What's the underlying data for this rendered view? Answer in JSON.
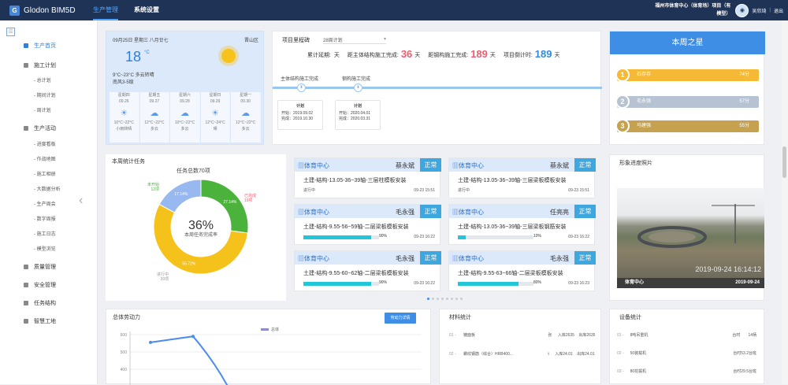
{
  "app": {
    "logo_text": "Glodon BIM5D",
    "logo_glyph": "G"
  },
  "nav": {
    "tabs": [
      "生产管理",
      "系统设置"
    ]
  },
  "header": {
    "project_line1": "福州市体育中心（体育场）项目（有",
    "project_line2": "模型）",
    "user": "吴欣琦",
    "logout": "退出"
  },
  "sidebar": {
    "sections": [
      {
        "label": "生产首页",
        "subs": []
      },
      {
        "label": "施工计划",
        "subs": [
          "总计划",
          "期间计划",
          "周计划"
        ]
      },
      {
        "label": "生产活动",
        "subs": [
          "进度看板",
          "作战地图",
          "施工相册",
          "大数据分析",
          "生产周会",
          "数字周报",
          "施工日志",
          "模型浏览"
        ]
      },
      {
        "label": "质量管理",
        "subs": []
      },
      {
        "label": "安全管理",
        "subs": []
      },
      {
        "label": "任务结构",
        "subs": []
      },
      {
        "label": "智慧工地",
        "subs": []
      }
    ]
  },
  "weather": {
    "date": "09月25日 星期三 八月廿七",
    "location": "晋山区",
    "temp": "18",
    "unit": "°C",
    "range": "9°C~23°C 多云转晴",
    "wind": "南风3-5级",
    "forecast": [
      {
        "day": "星期四",
        "date": "09.26",
        "icon": "sun-icon",
        "glyph": "☀",
        "temp": "10°C~22°C",
        "desc": "小雨转晴"
      },
      {
        "day": "星期五",
        "date": "09.27",
        "icon": "cloud-icon",
        "glyph": "☁",
        "temp": "12°C~22°C",
        "desc": "多云"
      },
      {
        "day": "星期六",
        "date": "09.28",
        "icon": "cloud-icon",
        "glyph": "☁",
        "temp": "10°C~22°C",
        "desc": "多云"
      },
      {
        "day": "星期日",
        "date": "09.29",
        "icon": "sun-icon",
        "glyph": "☀",
        "temp": "12°C~24°C",
        "desc": "晴"
      },
      {
        "day": "星期一",
        "date": "09.30",
        "icon": "cloud-icon",
        "glyph": "☁",
        "temp": "12°C~22°C",
        "desc": "多云"
      }
    ]
  },
  "milestone": {
    "title": "项目里程碑",
    "selected_plan": "28周计划",
    "stats": {
      "delay_label": "累计延期:",
      "delay_unit": "天",
      "main_label": "距主体结构施工完成:",
      "main_value": "36",
      "main_unit": "天",
      "steel_label": "距钢构施工完成:",
      "steel_value": "189",
      "steel_unit": "天",
      "countdown_label": "项目倒计时:",
      "countdown_value": "189",
      "countdown_unit": "天"
    },
    "nodes": [
      {
        "label": "主体结构施工完成",
        "title": "计划",
        "start": "开始：2019.09.02",
        "end": "完成：2019.10.30"
      },
      {
        "label": "钢构施工完成",
        "title": "计划",
        "start": "开始：2020.04.01",
        "end": "完成：2020.03.31"
      }
    ]
  },
  "stars": {
    "title": "本周之星",
    "items": [
      {
        "rank": "1",
        "name": "石存存",
        "score": "74分",
        "color": "#f5b935"
      },
      {
        "rank": "2",
        "name": "毛永强",
        "score": "57分",
        "color": "#b7c3d2"
      },
      {
        "rank": "3",
        "name": "马建强",
        "score": "55分",
        "color": "#c5a150"
      }
    ]
  },
  "tasks": {
    "title": "本周统计任务",
    "total": "任务总数70项",
    "center_pct": "36%",
    "center_label": "本周任务完成率",
    "segments": [
      {
        "name": "已完成",
        "pct": 27.14,
        "label": "27.14%",
        "color": "#4bb33b"
      },
      {
        "name": "进行中",
        "pct": 55.72,
        "label": "55.72%",
        "color": "#f5c21c"
      },
      {
        "name": "未开始",
        "pct": 17.14,
        "label": "17.14%",
        "color": "#98b9ef"
      }
    ],
    "outer_labels": {
      "done": "已完成\n19项",
      "doing": "进行中\n39项",
      "todo": "未开始\n12项"
    }
  },
  "task_cards": [
    {
      "org": "体育中心",
      "person": "蔡永斌",
      "status": "正常",
      "task": "土建-结构-13.05-36~39轴-三层柱模板安装",
      "progress_text": "进行中",
      "progress": null,
      "time": "09-23 15:51"
    },
    {
      "org": "体育中心",
      "person": "蔡永斌",
      "status": "正常",
      "task": "土建-结构-13.05-36~39轴-三层梁板模板安装",
      "progress_text": "进行中",
      "progress": null,
      "time": "09-23 15:51"
    },
    {
      "org": "体育中心",
      "person": "毛永强",
      "status": "正常",
      "task": "土建-结构-9.55-56~59轴-二层梁板模板安装",
      "progress_text": "",
      "progress": 90,
      "pct_label": "90%",
      "time": "09-23 16:22"
    },
    {
      "org": "体育中心",
      "person": "任亮亮",
      "status": "正常",
      "task": "土建-结构-13.05-36~39轴-三层梁板钢筋安装",
      "progress_text": "",
      "progress": 10,
      "pct_label": "10%",
      "time": "09-23 16:22"
    },
    {
      "org": "体育中心",
      "person": "毛永强",
      "status": "正常",
      "task": "土建-结构-9.55-60~62轴-二层梁板模板安装",
      "progress_text": "",
      "progress": 90,
      "pct_label": "90%",
      "time": "09-23 16:22"
    },
    {
      "org": "体育中心",
      "person": "毛永强",
      "status": "正常",
      "task": "土建-结构-9.55-63~66轴-二层梁板模板安装",
      "progress_text": "",
      "progress": 80,
      "pct_label": "80%",
      "time": "09-23 16:23"
    }
  ],
  "photo": {
    "title": "形象进度照片",
    "stamp": "2019-09-24 16:14:12",
    "caption_left": "体育中心",
    "caption_right": "2019-09-24"
  },
  "labor": {
    "title": "总体劳动力",
    "button": "劳动力详情",
    "legend": "总体",
    "chart_data": {
      "type": "line",
      "series": [
        {
          "name": "总体",
          "x": [
            1,
            2,
            3,
            4
          ],
          "values": [
            555,
            590,
            430,
            250
          ]
        }
      ],
      "yticks": [
        "600",
        "500",
        "400"
      ],
      "ylim": [
        400,
        600
      ]
    }
  },
  "materials": {
    "title": "材料统计",
    "rows": [
      {
        "no": "01 -",
        "name": "镀面板",
        "unit": "张",
        "in": "入库2635",
        "out": "出库2635"
      },
      {
        "no": "02 -",
        "name": "螺纹钢筋（综合）HRB400...",
        "unit": "t",
        "in": "入库24.01",
        "out": "出库24.01"
      }
    ]
  },
  "equipment": {
    "title": "设备统计",
    "rows": [
      {
        "no": "01 -",
        "name": "8吨吊重机",
        "unit": "台时",
        "value": "14柄"
      },
      {
        "no": "02 -",
        "name": "50装载机",
        "unit": "",
        "value": "台时53.2台班"
      },
      {
        "no": "03 -",
        "name": "80挖掘机",
        "unit": "",
        "value": "台时29.5台班"
      }
    ]
  },
  "colors": {
    "nav": "#1e3356",
    "accent": "#3f8ee6",
    "red": "#f25b6e"
  }
}
